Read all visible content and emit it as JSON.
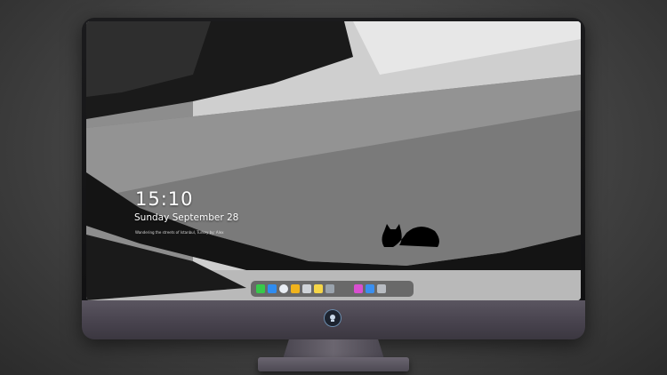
{
  "lockscreen": {
    "time": "15:10",
    "date": "Sunday September 28",
    "subline": "Wandering the streets of Istanbul, Turkey by: Alex"
  },
  "dock": {
    "items": [
      {
        "name": "messages",
        "icon": "messages-icon",
        "color": "#37c94a"
      },
      {
        "name": "finder",
        "icon": "finder-icon",
        "color": "#2f8cf0"
      },
      {
        "name": "safari",
        "icon": "safari-icon",
        "color": "#e9eef4"
      },
      {
        "name": "photos",
        "icon": "photos-icon",
        "color": "#f0b31c"
      },
      {
        "name": "media-center",
        "icon": "clapperboard-icon",
        "color": "#cfd3d8"
      },
      {
        "name": "notes",
        "icon": "notes-icon",
        "color": "#f6d648"
      },
      {
        "name": "preview",
        "icon": "preview-icon",
        "color": "#9aa3ad"
      },
      {
        "name": "itunes",
        "icon": "music-icon",
        "color": "#d94fd0"
      },
      {
        "name": "app-store",
        "icon": "app-store-icon",
        "color": "#3a8ff0"
      },
      {
        "name": "screenshot",
        "icon": "camera-icon",
        "color": "#b8bcc2"
      }
    ]
  }
}
